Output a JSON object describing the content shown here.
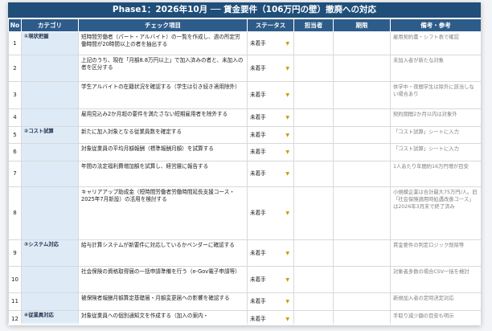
{
  "title": "Phase1：2026年10月 ── 賃金要件（106万円の壁）撤廃への対応",
  "headers": {
    "no": "No",
    "category": "カテゴリ",
    "item": "チェック項目",
    "status": "ステータス",
    "owner": "担当者",
    "due": "期限",
    "note": "備考・参考"
  },
  "categories": {
    "c1": "①現状把握",
    "c2": "②コスト試算",
    "c3": "③システム対応",
    "c4": "④従業員対応"
  },
  "status_default": "未着手",
  "rows": [
    {
      "no": "1",
      "item": "短時間労働者（パート・アルバイト）の一覧を作成し、週の所定労働時間が20時間以上の者を抽出する",
      "status": "未着手",
      "note": "雇用契約書・シフト表で確認"
    },
    {
      "no": "2",
      "item": "上記のうち、現在「月額8.8万円以上」で加入済みの者と、未加入の者を区分する",
      "status": "未着手",
      "note": "未加入者が新たな対象"
    },
    {
      "no": "3",
      "item": "学生アルバイトの在籍状況を確認する（学生は引き続き適用除外）",
      "status": "未着手",
      "note": "休学中・夜間学生は除外に該当しない場合あり"
    },
    {
      "no": "4",
      "item": "雇用見込み2か月超の要件を満たさない短期雇用者を除外する",
      "status": "未着手",
      "note": "契約期間2か月以内は対象外"
    },
    {
      "no": "5",
      "item": "新たに加入対象となる従業員数を確定する",
      "status": "未着手",
      "note": "「コスト試算」シートに入力"
    },
    {
      "no": "6",
      "item": "対象従業員の平均月額報酬（標準報酬月額）を試算する",
      "status": "未着手",
      "note": "「コスト試算」シートに入力"
    },
    {
      "no": "7",
      "item": "年間の法定福利費増加額を試算し、経営層に報告する",
      "status": "未着手",
      "note": "1人あたり年間約16万円増が目安"
    },
    {
      "no": "8",
      "item": "キャリアアップ助成金（短時間労働者労働時間延長支援コース・2025年7月新設）の活用を検討する",
      "status": "未着手",
      "note": "小規模企業は合計最大75万円/人。旧「社会保険適用時処遇改善コース」は2026年3月末で終了済み"
    },
    {
      "no": "9",
      "item": "給与計算システムが新要件に対応しているかベンダーに確認する",
      "status": "未着手",
      "note": "賃金要件の判定ロジック削除等"
    },
    {
      "no": "10",
      "item": "社会保険の資格取得届の一括申請準備を行う（e-Gov電子申請等）",
      "status": "未着手",
      "note": "対象者多数の場合CSV一括を検討"
    },
    {
      "no": "11",
      "item": "被保険者報酬月額算定基礎届・月額変更届への影響を確認する",
      "status": "未着手",
      "note": "新規加入者の定時決定対応"
    },
    {
      "no": "12",
      "item": "対象従業員への個別通知文を作成する（加入の案内・",
      "status": "未着手",
      "note": "手取り減少額の目安も明示"
    }
  ]
}
